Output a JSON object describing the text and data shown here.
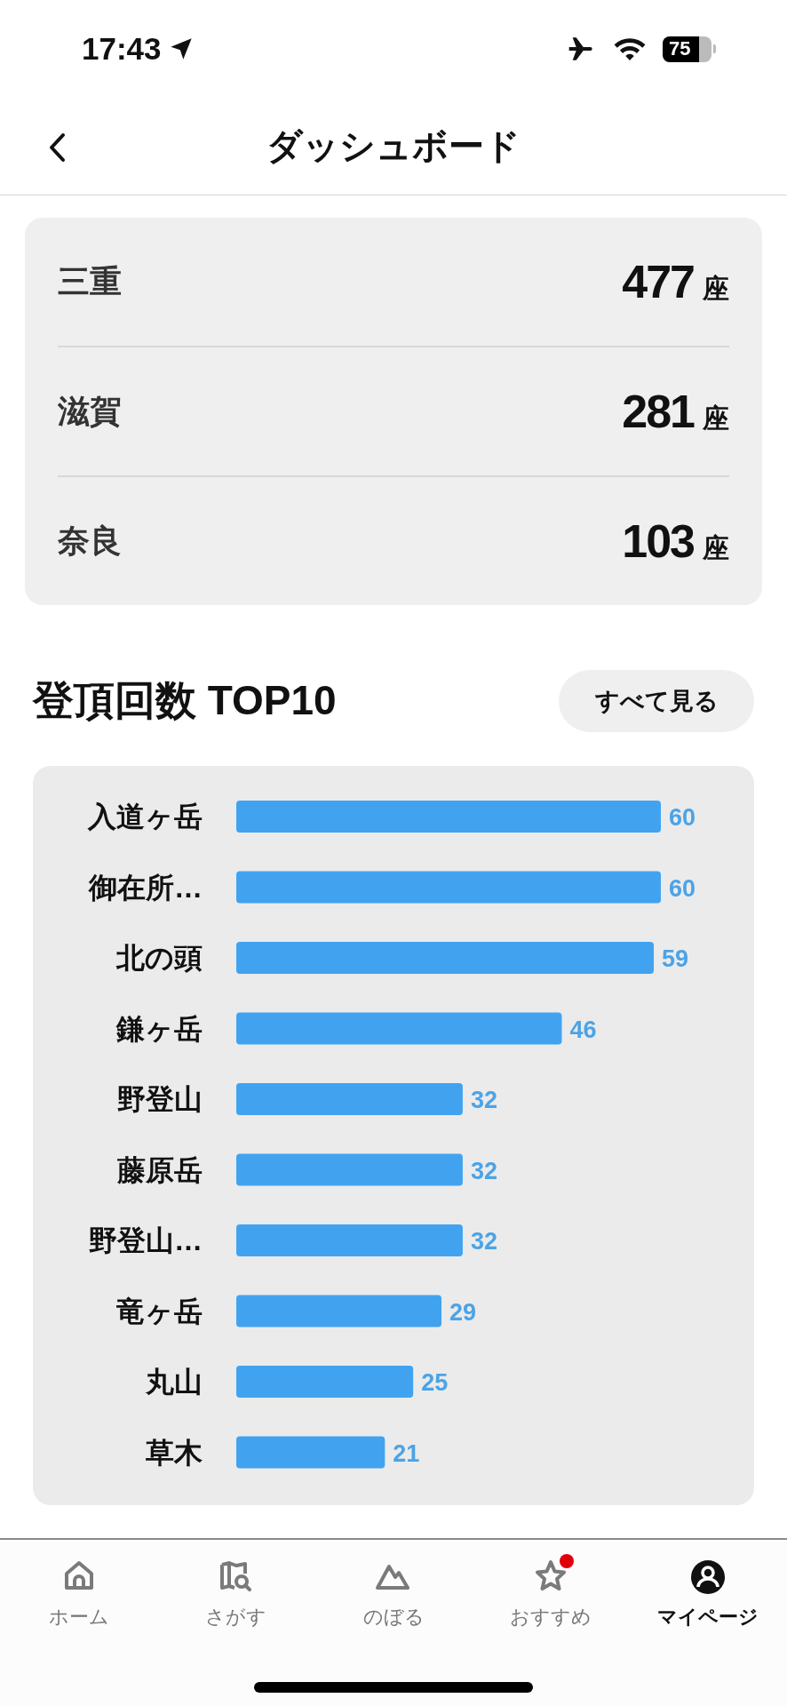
{
  "status_bar": {
    "time": "17:43",
    "battery": "75"
  },
  "header": {
    "title": "ダッシュボード"
  },
  "prefectures": [
    {
      "name": "三重",
      "count": "477",
      "unit": "座"
    },
    {
      "name": "滋賀",
      "count": "281",
      "unit": "座"
    },
    {
      "name": "奈良",
      "count": "103",
      "unit": "座"
    }
  ],
  "ranking": {
    "title": "登頂回数 TOP10",
    "button": "すべて見る",
    "chart_data": {
      "type": "bar",
      "orientation": "horizontal",
      "data_labels": true,
      "categories": [
        "入道ヶ岳",
        "御在所…",
        "北の頭",
        "鎌ヶ岳",
        "野登山",
        "藤原岳",
        "野登山…",
        "竜ヶ岳",
        "丸山",
        "草木"
      ],
      "values": [
        60,
        60,
        59,
        46,
        32,
        32,
        32,
        29,
        25,
        21
      ]
    }
  },
  "tabs": [
    {
      "label": "ホーム",
      "selected": false,
      "badge": false
    },
    {
      "label": "さがす",
      "selected": false,
      "badge": false
    },
    {
      "label": "のぼる",
      "selected": false,
      "badge": false
    },
    {
      "label": "おすすめ",
      "selected": false,
      "badge": true
    },
    {
      "label": "マイページ",
      "selected": true,
      "badge": false
    }
  ]
}
